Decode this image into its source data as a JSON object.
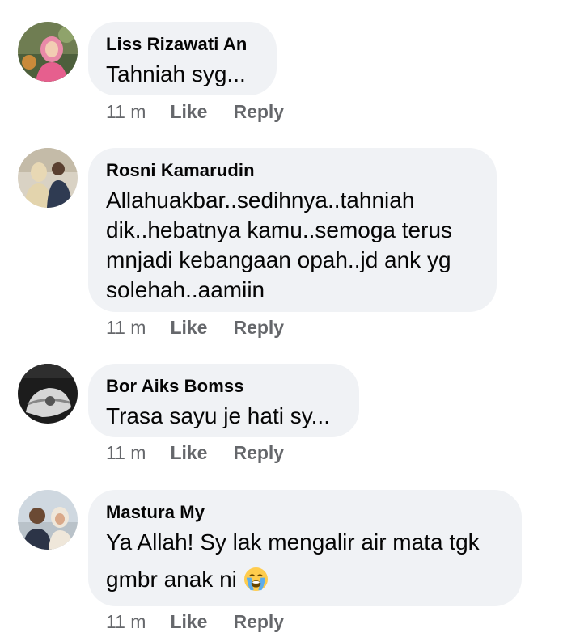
{
  "comments": [
    {
      "author": "Liss Rizawati An",
      "text": "Tahniah syg...",
      "time": "11 m",
      "like_label": "Like",
      "reply_label": "Reply"
    },
    {
      "author": "Rosni Kamarudin",
      "text": "Allahuakbar..sedihnya..tahniah dik..hebatnya kamu..semoga terus mnjadi kebangaan opah..jd ank yg solehah..aamiin",
      "time": "11 m",
      "like_label": "Like",
      "reply_label": "Reply"
    },
    {
      "author": "Bor Aiks Bomss",
      "text": "Trasa sayu je hati sy...",
      "time": "11 m",
      "like_label": "Like",
      "reply_label": "Reply"
    },
    {
      "author": "Mastura My",
      "text_line1": "Ya Allah! Sy lak mengalir air mata tgk",
      "text_line2": "gmbr anak ni",
      "emoji": "loudly-crying-face-emoji",
      "time": "11 m",
      "like_label": "Like",
      "reply_label": "Reply"
    }
  ],
  "colors": {
    "bubble_bg": "#f0f2f5",
    "meta_text": "#65676b",
    "author_text": "#050505"
  }
}
